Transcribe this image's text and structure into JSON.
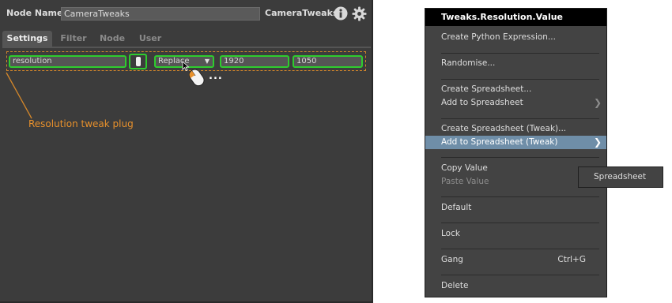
{
  "node_editor": {
    "node_name_label": "Node Name",
    "node_name_value": "CameraTweaks",
    "node_type": "CameraTweaks",
    "info_icon": "info-icon",
    "gear_icon": "gear-icon",
    "tabs": [
      {
        "label": "Settings",
        "active": true
      },
      {
        "label": "Filter",
        "active": false
      },
      {
        "label": "Node",
        "active": false
      },
      {
        "label": "User",
        "active": false
      }
    ],
    "plug": {
      "name": "resolution",
      "mode": "Replace",
      "value_x": "1920",
      "value_y": "1050"
    },
    "annotation": "Resolution tweak plug",
    "ellipsis": "...",
    "colors": {
      "highlight": "#2ecc2e",
      "annotation": "#e8912c"
    }
  },
  "context_menu": {
    "title": "Tweaks.Resolution.Value",
    "items": [
      {
        "label": "Create Python Expression..."
      },
      {
        "label": "Randomise..."
      },
      {
        "label": "Create Spreadsheet..."
      },
      {
        "label": "Add to Spreadsheet",
        "submenu": true
      },
      {
        "label": "Create Spreadsheet (Tweak)..."
      },
      {
        "label": "Add to Spreadsheet (Tweak)",
        "submenu": true,
        "highlighted": true
      },
      {
        "label": "Copy Value"
      },
      {
        "label": "Paste Value",
        "disabled": true
      },
      {
        "label": "Default"
      },
      {
        "label": "Lock"
      },
      {
        "label": "Gang",
        "shortcut": "Ctrl+G"
      },
      {
        "label": "Delete"
      }
    ],
    "submenu_items": [
      "Spreadsheet"
    ],
    "highlight_color": "#6f8ea8"
  }
}
